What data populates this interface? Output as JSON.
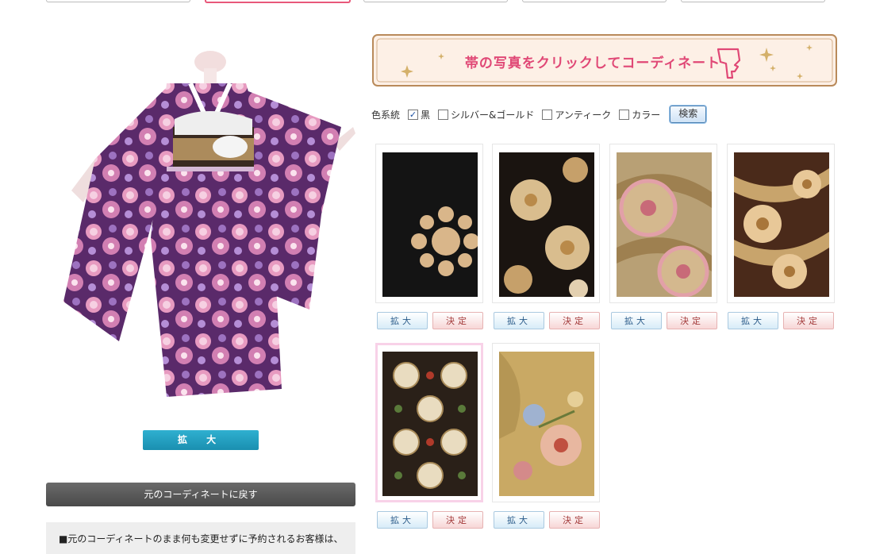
{
  "banner": {
    "text": "帯の写真をクリックしてコーディネート"
  },
  "filters": {
    "label": "色系統",
    "options": [
      {
        "label": "黒",
        "checked": true
      },
      {
        "label": "シルバー&ゴールド",
        "checked": false
      },
      {
        "label": "アンティーク",
        "checked": false
      },
      {
        "label": "カラー",
        "checked": false
      }
    ],
    "search_label": "検索"
  },
  "main_zoom_label": "拡 大",
  "back_button_label": "元のコーディネートに戻す",
  "note_text": "■元のコーディネートのまま何も変更せずに予約されるお客様は、",
  "obi_items": [
    {
      "zoom_label": "拡大",
      "decide_label": "決定"
    },
    {
      "zoom_label": "拡大",
      "decide_label": "決定"
    },
    {
      "zoom_label": "拡大",
      "decide_label": "決定"
    },
    {
      "zoom_label": "拡大",
      "decide_label": "決定"
    },
    {
      "zoom_label": "拡大",
      "decide_label": "決定",
      "selected": true
    },
    {
      "zoom_label": "拡大",
      "decide_label": "決定"
    }
  ],
  "colors": {
    "accent_pink": "#e04876",
    "zoom_blue": "#1a8fb0",
    "back_gray": "#555555"
  }
}
